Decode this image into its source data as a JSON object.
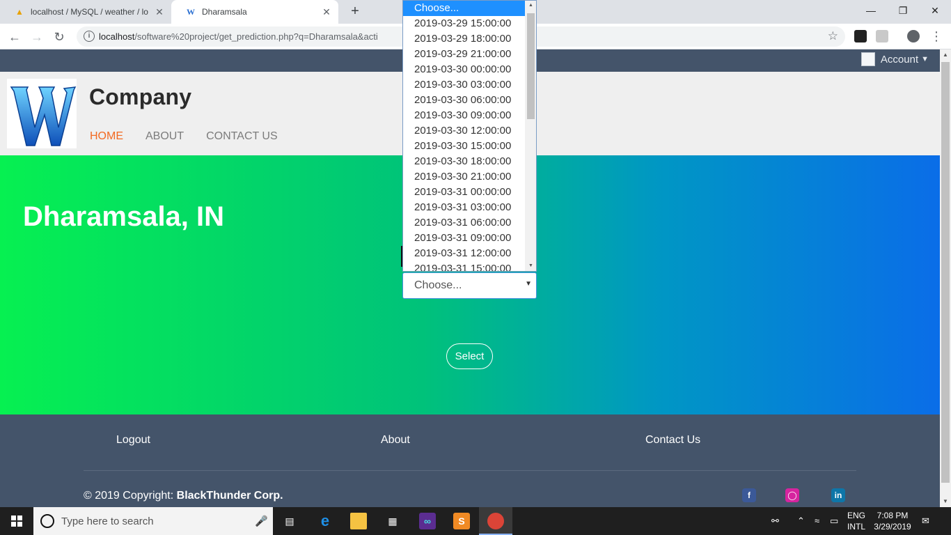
{
  "browser": {
    "tabs": [
      {
        "title": "localhost / MySQL / weather / lo",
        "favicon": "phpmyadmin-icon",
        "active": false
      },
      {
        "title": "Dharamsala",
        "favicon": "w-icon",
        "active": true
      }
    ],
    "url_host": "localhost",
    "url_path": "/software%20project/get_prediction.php?q=Dharamsala&acti"
  },
  "page": {
    "account_label": "Account",
    "brand": "Company",
    "nav": {
      "home": "HOME",
      "about": "ABOUT",
      "contact": "CONTACT US"
    },
    "city": "Dharamsala, IN",
    "select_value": "Choose...",
    "select_button": "Select",
    "dropdown_options": [
      "Choose...",
      "2019-03-29 15:00:00",
      "2019-03-29 18:00:00",
      "2019-03-29 21:00:00",
      "2019-03-30 00:00:00",
      "2019-03-30 03:00:00",
      "2019-03-30 06:00:00",
      "2019-03-30 09:00:00",
      "2019-03-30 12:00:00",
      "2019-03-30 15:00:00",
      "2019-03-30 18:00:00",
      "2019-03-30 21:00:00",
      "2019-03-31 00:00:00",
      "2019-03-31 03:00:00",
      "2019-03-31 06:00:00",
      "2019-03-31 09:00:00",
      "2019-03-31 12:00:00",
      "2019-03-31 15:00:00"
    ],
    "footer": {
      "logout": "Logout",
      "about": "About",
      "contact": "Contact Us",
      "copyright_prefix": "© 2019 Copyright:",
      "copyright_brand": "BlackThunder Corp."
    }
  },
  "colors": {
    "accent_orange": "#f26a22",
    "dark_slate": "#44546a",
    "gradient_start": "#06f051",
    "gradient_end": "#0a6de8"
  },
  "taskbar": {
    "search_placeholder": "Type here to search",
    "language": [
      "ENG",
      "INTL"
    ],
    "time": "7:08 PM",
    "date": "3/29/2019"
  }
}
